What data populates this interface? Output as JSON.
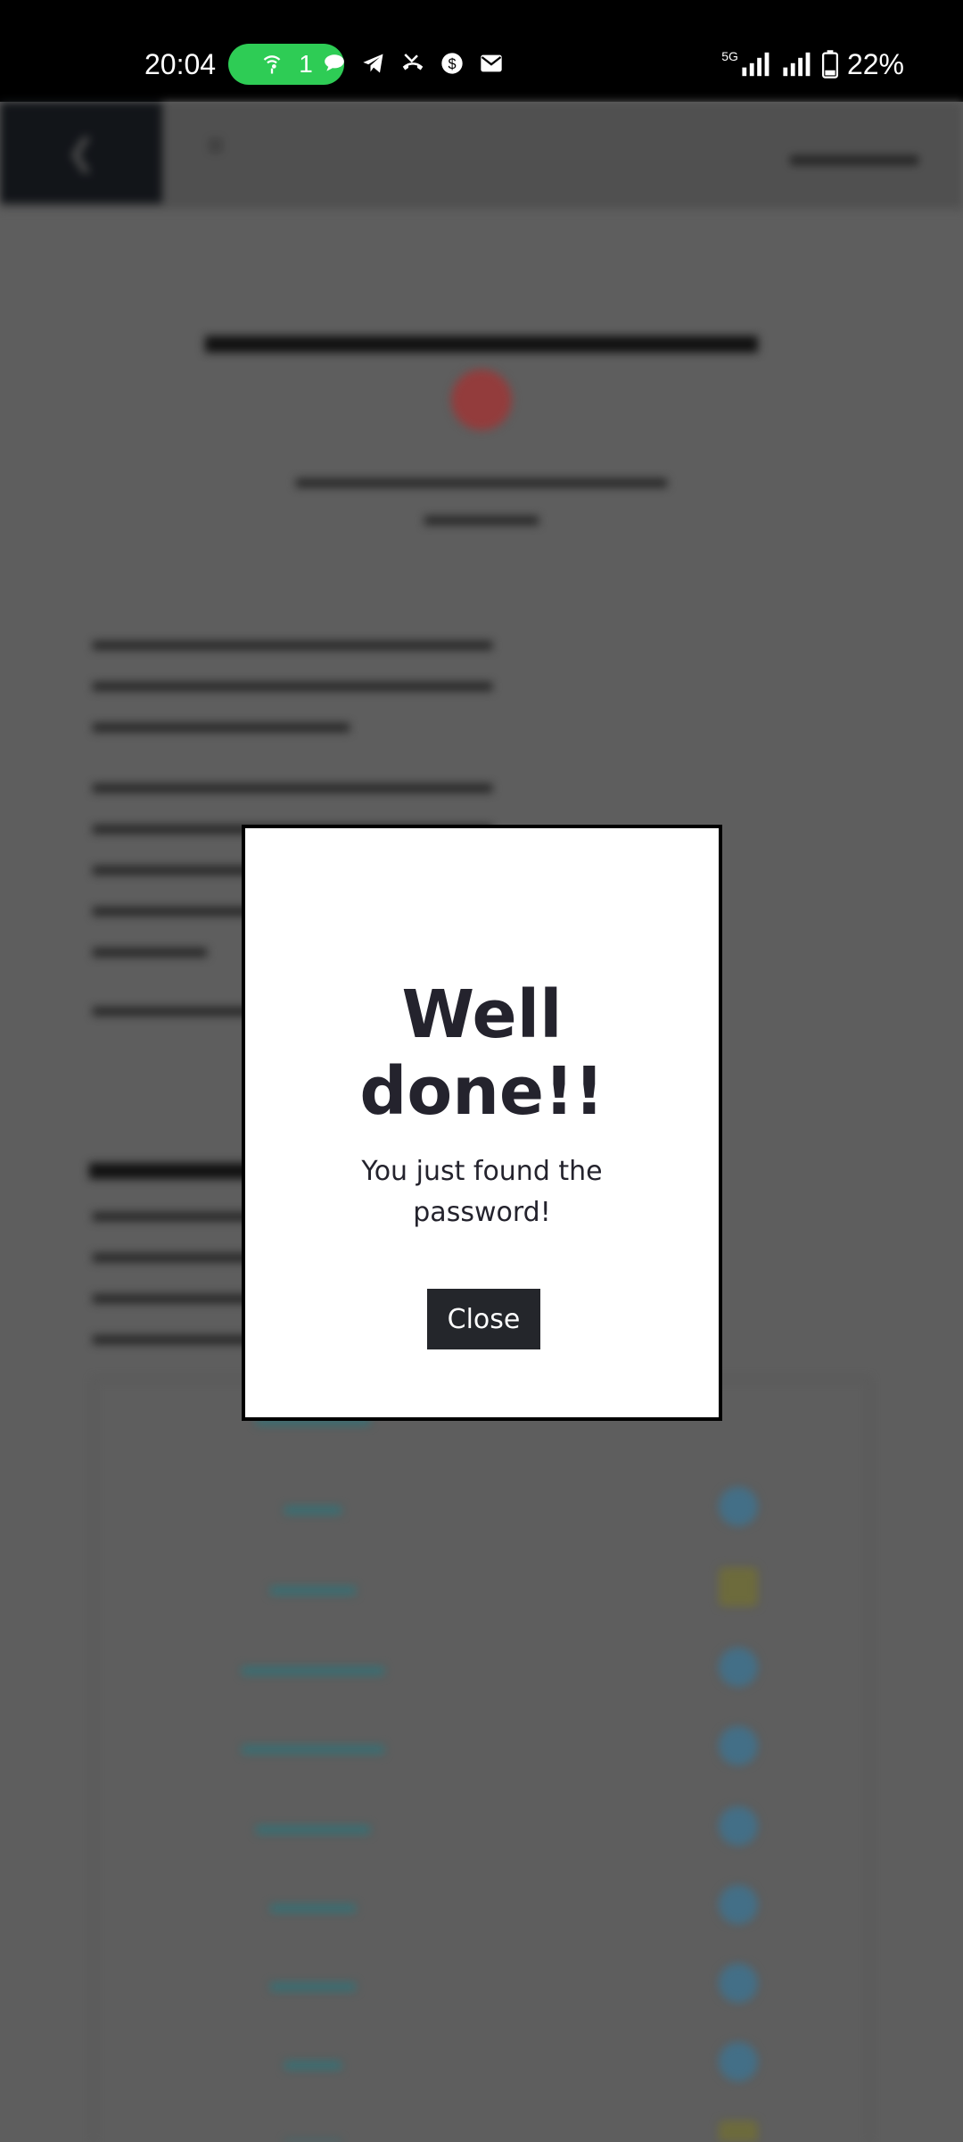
{
  "status_bar": {
    "time": "20:04",
    "hotspot_count": "1",
    "network": "5G",
    "battery": "22%",
    "notification_icons": [
      "chat-bubble-icon",
      "telegram-icon",
      "missed-call-icon",
      "dollar-circle-icon",
      "mail-icon"
    ]
  },
  "modal": {
    "title_line1": "Well",
    "title_line2": "done!!",
    "message_line1": "You just found the",
    "message_line2": "password!",
    "close_label": "Close"
  },
  "colors": {
    "hotspot_green": "#2ecc55",
    "modal_text": "#24232d",
    "button_bg": "#24262b"
  }
}
